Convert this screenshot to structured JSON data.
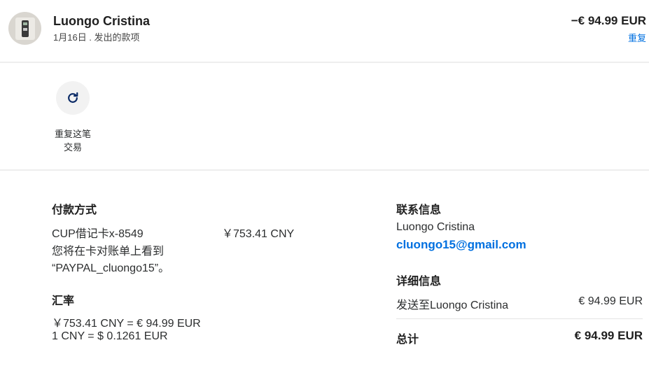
{
  "header": {
    "name": "Luongo Cristina",
    "subtitle": "1月16日 . 发出的款项",
    "amount": "−€ 94.99 EUR",
    "repeat_link": "重复"
  },
  "actions": {
    "repeat_label_line1": "重复这笔",
    "repeat_label_line2": "交易",
    "icon": "refresh-icon"
  },
  "payment": {
    "title": "付款方式",
    "card": "CUP借记卡x-8549",
    "card_amount": "￥753.41 CNY",
    "statement_line1": "您将在卡对账单上看到",
    "statement_line2": "“PAYPAL_cluongo15”。"
  },
  "exchange": {
    "title": "汇率",
    "line1": "￥753.41 CNY = € 94.99 EUR",
    "line2": "1 CNY = $ 0.1261 EUR"
  },
  "contact": {
    "title": "联系信息",
    "name": "Luongo Cristina",
    "email": "cluongo15@gmail.com"
  },
  "details": {
    "title": "详细信息",
    "sent_to": "发送至Luongo Cristina",
    "sent_amount": "€ 94.99 EUR",
    "total_label": "总计",
    "total_amount": "€ 94.99 EUR"
  },
  "colors": {
    "accent": "#0070e0",
    "divider": "#eeeeee",
    "text": "#2c2e2f"
  }
}
